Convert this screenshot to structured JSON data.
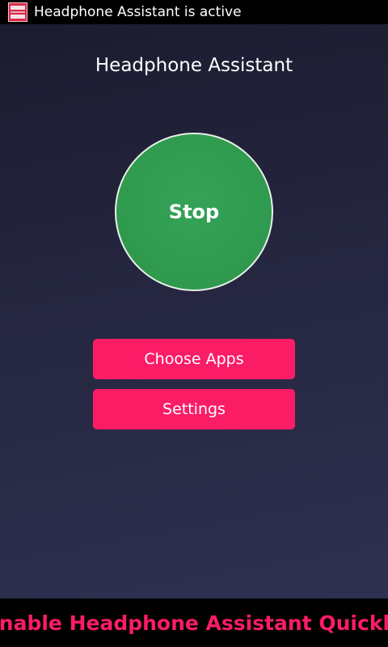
{
  "status_bar": {
    "notification_icon": "app-notification-icon",
    "text": "Headphone Assistant is active"
  },
  "app": {
    "title": "Headphone Assistant",
    "toggle_label": "Stop",
    "buttons": {
      "choose_apps": "Choose Apps",
      "settings": "Settings"
    }
  },
  "banner": {
    "text": "Enable Headphone Assistant Quickly"
  },
  "colors": {
    "accent_pink": "#fb1c66",
    "toggle_green": "#2f9a4e",
    "background_dark": "#1c1c30"
  }
}
